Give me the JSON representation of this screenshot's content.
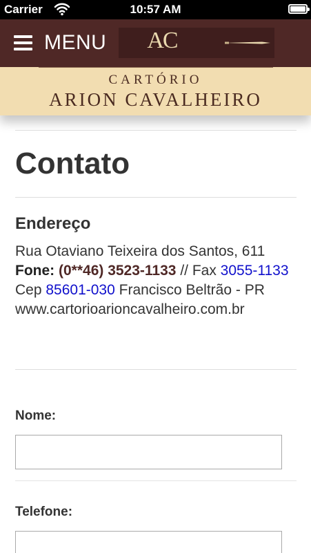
{
  "status_bar": {
    "carrier": "Carrier",
    "time": "10:57 AM"
  },
  "header": {
    "menu_label": "MENU",
    "logo_monogram": "AC",
    "brand_line1": "CARTÓRIO",
    "brand_line2": "ARION CAVALHEIRO",
    "colors": {
      "top_bar": "#4f2826",
      "logo_panel": "#3f1e1d",
      "brand_band": "#f2ddb1"
    }
  },
  "page": {
    "title": "Contato"
  },
  "address": {
    "heading": "Endereço",
    "street": "Rua Otaviano Teixeira dos Santos, 611",
    "phone_label": "Fone:",
    "phone_number": "(0**46) 3523-1133",
    "fax_separator": " // Fax ",
    "fax_number": "3055-1133",
    "cep_label": "Cep ",
    "cep_number": "85601-030",
    "city": " Francisco Beltrão - PR",
    "website": "www.cartorioarioncavalheiro.com.br"
  },
  "form": {
    "name_label": "Nome:",
    "name_value": "",
    "phone_label": "Telefone:",
    "phone_value": ""
  }
}
